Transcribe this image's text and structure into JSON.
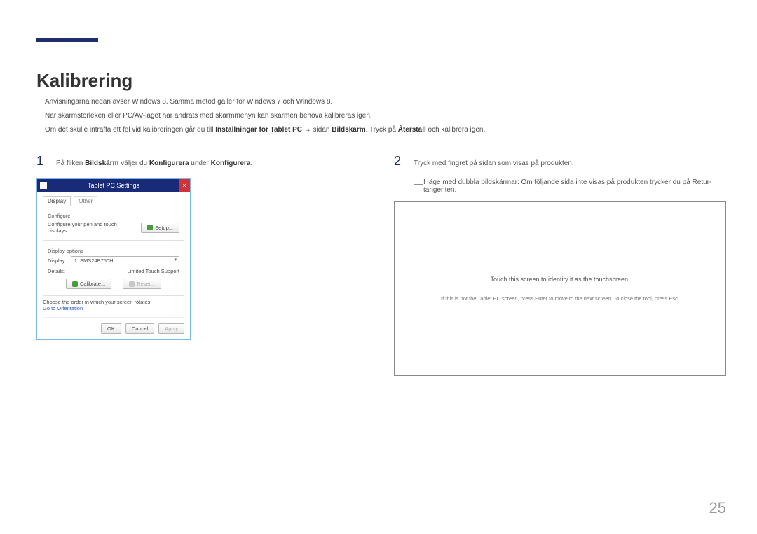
{
  "heading": "Kalibrering",
  "intro": [
    "Anvisningarna nedan avser Windows 8. Samma metod gäller för Windows 7 och Windows 8.",
    "När skärmstorleken eller PC/AV-läget har ändrats med skärmmenyn kan skärmen behöva kalibreras igen."
  ],
  "intro3_parts": {
    "a": "Om det skulle inträffa ett fel vid kalibreringen går du till ",
    "b": "Inställningar för Tablet PC",
    "c": " → sidan ",
    "d": "Bildskärm",
    "e": ". Tryck på ",
    "f": "Återställ",
    "g": " och kalibrera igen."
  },
  "step1": {
    "num": "1",
    "a": "På fliken ",
    "b": "Bildskärm",
    "c": " väljer du ",
    "d": "Konfigurera",
    "e": " under ",
    "f": "Konfigurera",
    "g": "."
  },
  "dialog": {
    "title": "Tablet PC Settings",
    "tabs": {
      "display": "Display",
      "other": "Other"
    },
    "configure": {
      "group": "Configure",
      "line": "Configure your pen and touch displays.",
      "setup": "Setup..."
    },
    "display_options": {
      "group": "Display options",
      "display_label": "Display:",
      "display_value": "1. SMS24B750H",
      "details_label": "Details:",
      "details_value": "Limited Touch Support",
      "calibrate": "Calibrate...",
      "reset": "Reset..."
    },
    "orientation": {
      "line": "Choose the order in which your screen rotates.",
      "link": "Go to Orientation"
    },
    "buttons": {
      "ok": "OK",
      "cancel": "Cancel",
      "apply": "Apply"
    }
  },
  "step2": {
    "num": "2",
    "text": "Tryck med fingret på sidan som visas på produkten."
  },
  "sub_note": "I läge med dubbla bildskärmar: Om följande sida inte visas på produkten trycker du på Retur-tangenten.",
  "touch_box": {
    "main": "Touch this screen to identity it as the touchscreen.",
    "sub": "If this is not the Tablet PC screen, press Enter to move to the next screen. To close the tool, press Esc."
  },
  "page_number": "25"
}
